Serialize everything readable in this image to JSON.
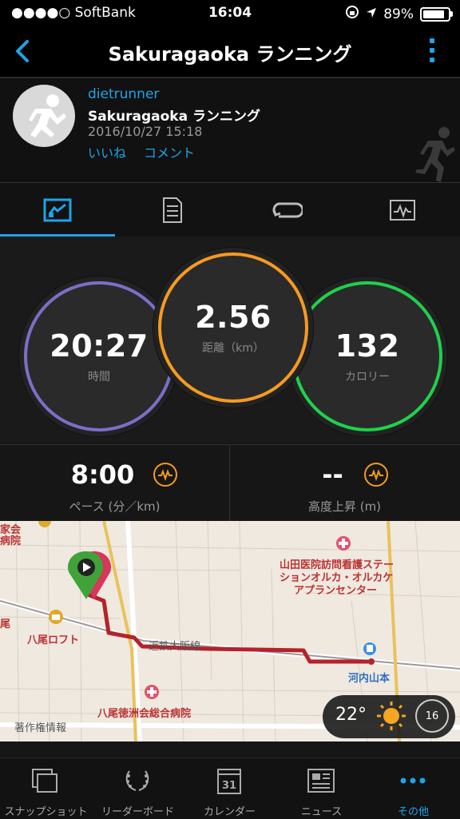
{
  "status_bar": {
    "carrier": "●●●●○ SoftBank",
    "time": "16:04",
    "battery": "89%"
  },
  "nav": {
    "title": "Sakuragaoka ランニング"
  },
  "activity": {
    "user": "dietrunner",
    "title": "Sakuragaoka ランニング",
    "datetime": "2016/10/27 15:18",
    "like": "いいね",
    "comment": "コメント"
  },
  "metrics": {
    "time": {
      "value": "20:27",
      "label": "時間"
    },
    "distance": {
      "value": "2.56",
      "label": "距離（km）"
    },
    "calories": {
      "value": "132",
      "label": "カロリー"
    },
    "pace": {
      "value": "8:00",
      "label": "ペース (分／km)"
    },
    "elevation": {
      "value": "--",
      "label": "高度上昇 (m)"
    }
  },
  "map": {
    "labels": {
      "hospital_top": "山田医院訪問看護ステー",
      "hospital_mid": "ションオルカ・オルカケ",
      "hospital_bot": "アプランセンター",
      "loft": "八尾ロフト",
      "line": "近鉄大阪線",
      "station": "河内山本",
      "hospital2": "八尾徳洲会総合病院",
      "copyright": "著作権情報",
      "partial_top": "家会",
      "partial_top2": "病院",
      "partial_left": "尾"
    }
  },
  "weather": {
    "temperature": "22°",
    "wind": "16"
  },
  "bottom_tabs": [
    "スナップショット",
    "リーダーボード",
    "カレンダー",
    "ニュース",
    "その他"
  ],
  "calendar_day": "31",
  "colors": {
    "accent": "#1ea4e8",
    "time_ring": "#7b6fc9",
    "distance_ring": "#f59a23",
    "calories_ring": "#1fd14c",
    "route": "#b5222a"
  }
}
